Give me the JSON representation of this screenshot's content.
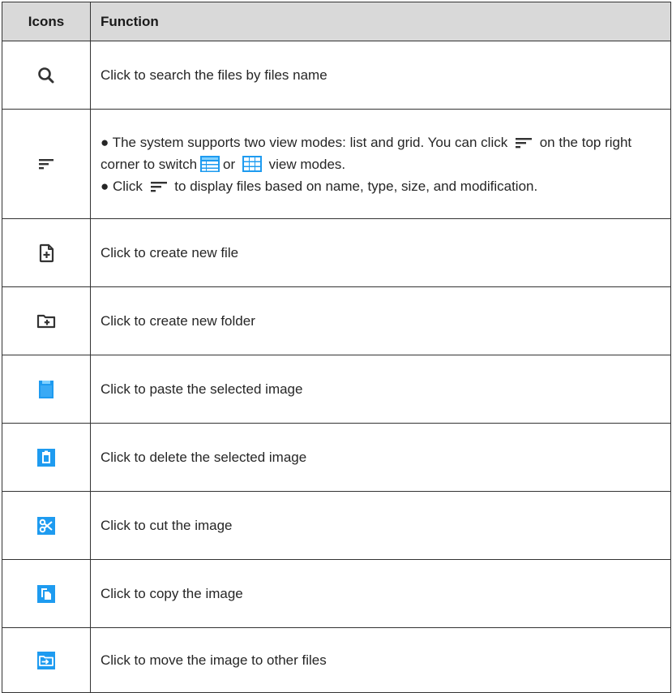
{
  "header": {
    "icons_label": "Icons",
    "function_label": "Function"
  },
  "rows": [
    {
      "icon": "search-icon",
      "text": "Click to search the files by files name"
    },
    {
      "icon": "sort-icon",
      "p1_a": "● The system supports two view modes: list and grid. You can click",
      "p1_b": "on",
      "p1_c": "the top right corner to switch",
      "p1_d": "or",
      "p1_e": "view modes.",
      "p2_a": "● Click",
      "p2_b": "to display files based on name, type, size, and modification."
    },
    {
      "icon": "new-file-icon",
      "text": "Click to create new file"
    },
    {
      "icon": "new-folder-icon",
      "text": "Click to create new folder"
    },
    {
      "icon": "paste-icon",
      "text": "Click to paste the selected image"
    },
    {
      "icon": "delete-icon",
      "text": "Click to delete the selected image"
    },
    {
      "icon": "cut-icon",
      "text": "Click to cut the image"
    },
    {
      "icon": "copy-icon",
      "text": "Click to copy the image"
    },
    {
      "icon": "move-icon",
      "text": "Click to move the image to other files"
    }
  ],
  "colors": {
    "header_bg": "#d9d9d9",
    "border": "#333333",
    "accent_blue": "#1e9bf0",
    "icon_dark": "#333333"
  }
}
